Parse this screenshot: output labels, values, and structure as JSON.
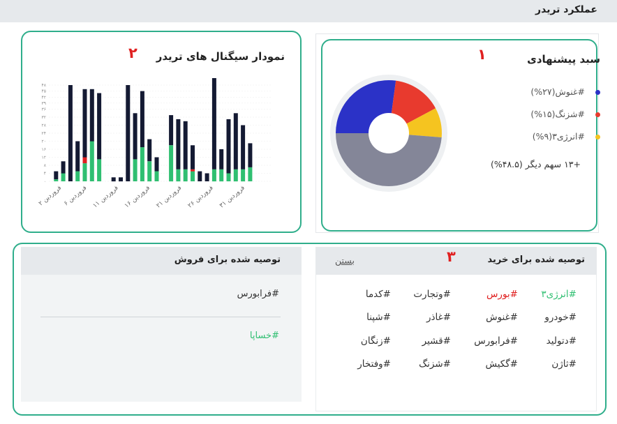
{
  "header": {
    "title": "عملکرد تریدر"
  },
  "pie_card": {
    "marker": "۱",
    "title": "سبد پیشنهادی",
    "legend": [
      {
        "label": "#غنوش",
        "pct": "(۲۷%)",
        "color": "#2b32c7"
      },
      {
        "label": "#شزنگ",
        "pct": "(۱۵%)",
        "color": "#e83a2e"
      },
      {
        "label": "#انرژی۳",
        "pct": "(۹%)",
        "color": "#f5c420"
      }
    ],
    "more": "+۱۳ سهم دیگر (۴۸.۵%)"
  },
  "chart_card": {
    "marker": "۲",
    "title": "نمودار سیگنال های تریدر"
  },
  "chart_data": {
    "type": "bar",
    "stacked": true,
    "ylim": [
      0,
      48
    ],
    "yticks": [
      "۰",
      "۴",
      "۸",
      "۱۲",
      "۱۶",
      "۲۰",
      "۲۴",
      "۲۸",
      "۳۲",
      "۳۶",
      "۳۹",
      "۴۲",
      "۴۵",
      "۴۸"
    ],
    "xlabels": [
      "۲ فروردین",
      "۶ فروردین",
      "۱۱ فروردین",
      "۱۶ فروردین",
      "۲۱ فروردین",
      "۲۶ فروردین",
      "۳۱ فروردین"
    ],
    "bar_days": [
      1,
      2,
      3,
      4,
      5,
      6,
      7,
      9,
      10,
      11,
      12,
      13,
      14,
      15,
      17,
      18,
      19,
      20,
      21,
      22,
      23,
      24,
      25,
      26,
      27,
      28
    ],
    "series": [
      {
        "color": "#2fbf71",
        "values": [
          1,
          4,
          0,
          5,
          9,
          20,
          11,
          0,
          0,
          0,
          11,
          17,
          10,
          5,
          18,
          6,
          6,
          5,
          0,
          0,
          6,
          6,
          4,
          6,
          6,
          7
        ]
      },
      {
        "color": "#e02020",
        "values": [
          0,
          0,
          0,
          0,
          3,
          0,
          0,
          0,
          0,
          0,
          0,
          0,
          0,
          0,
          0,
          0,
          0,
          1,
          0,
          0,
          0,
          0,
          0,
          0,
          0,
          0
        ]
      },
      {
        "color": "#141a33",
        "values": [
          4,
          6,
          48,
          15,
          34,
          26,
          33,
          2,
          2,
          48,
          23,
          28,
          11,
          7,
          15,
          25,
          24,
          12,
          5,
          4,
          49,
          10,
          27,
          28,
          22,
          12
        ]
      }
    ]
  },
  "pie_data": {
    "type": "pie",
    "slices": [
      {
        "label": "#غنوش",
        "value": 27,
        "color": "#2b32c7"
      },
      {
        "label": "#شزنگ",
        "value": 15,
        "color": "#e83a2e"
      },
      {
        "label": "#انرژی۳",
        "value": 9,
        "color": "#f5c420"
      },
      {
        "label": "+۱۳ سهم دیگر",
        "value": 48.5,
        "color": "#848698"
      }
    ]
  },
  "buy": {
    "marker": "۳",
    "title": "توصیه شده برای خرید",
    "close_label": "بستن",
    "rows": [
      [
        {
          "text": "#انرژی۳",
          "color": "#2fbf71"
        },
        {
          "text": "#بورس",
          "color": "#e02020"
        },
        {
          "text": "#وتجارت",
          "color": "#333333"
        },
        {
          "text": "#کدما",
          "color": "#333333"
        }
      ],
      [
        {
          "text": "#خودرو",
          "color": "#333333"
        },
        {
          "text": "#غنوش",
          "color": "#333333"
        },
        {
          "text": "#غاذر",
          "color": "#333333"
        },
        {
          "text": "#شپنا",
          "color": "#333333"
        }
      ],
      [
        {
          "text": "#دتولید",
          "color": "#333333"
        },
        {
          "text": "#فرابورس",
          "color": "#333333"
        },
        {
          "text": "#قشیر",
          "color": "#333333"
        },
        {
          "text": "#زنگان",
          "color": "#333333"
        }
      ],
      [
        {
          "text": "#ثاژن",
          "color": "#333333"
        },
        {
          "text": "#گکیش",
          "color": "#333333"
        },
        {
          "text": "#شزنگ",
          "color": "#333333"
        },
        {
          "text": "#وفتخار",
          "color": "#333333"
        }
      ]
    ]
  },
  "sell": {
    "title": "توصیه شده برای فروش",
    "items": [
      {
        "text": "#فرابورس",
        "color": "#333333"
      },
      {
        "text": "#خساپا",
        "color": "#2fbf71"
      }
    ]
  }
}
